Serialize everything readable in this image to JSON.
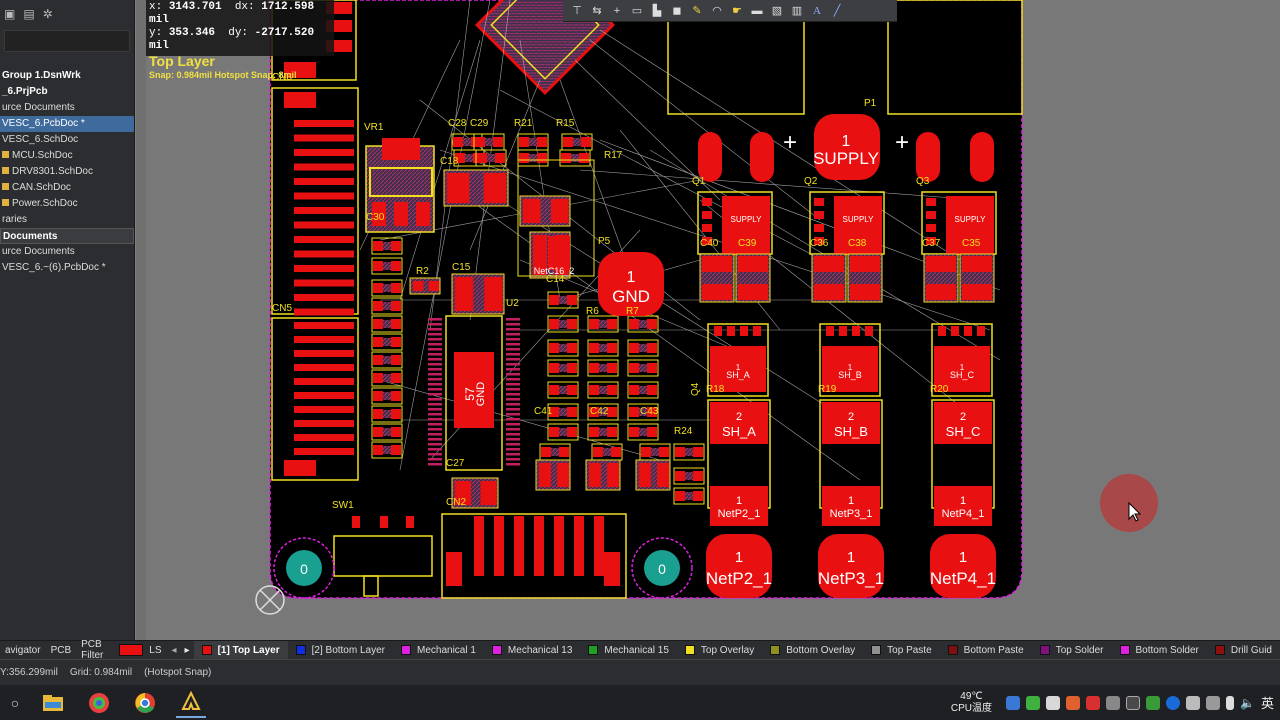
{
  "left_panel": {
    "items": [
      {
        "label": "Group 1.DsnWrk",
        "style": "bold"
      },
      {
        "label": "_6.PrjPcb",
        "style": "bold"
      },
      {
        "label": "urce Documents",
        "style": ""
      },
      {
        "label": "VESC_6.PcbDoc *",
        "style": "sel"
      },
      {
        "label": "VESC_6.SchDoc",
        "style": ""
      },
      {
        "label": "MCU.SchDoc",
        "style": "folder"
      },
      {
        "label": "DRV8301.SchDoc",
        "style": "folder"
      },
      {
        "label": "CAN.SchDoc",
        "style": "folder"
      },
      {
        "label": "Power.SchDoc",
        "style": "folder"
      },
      {
        "label": "raries",
        "style": ""
      },
      {
        "label": "Documents",
        "style": "hdr"
      },
      {
        "label": "urce Documents",
        "style": ""
      },
      {
        "label": "VESC_6.~(6).PcbDoc *",
        "style": ""
      }
    ]
  },
  "coords": {
    "x_label": "x:",
    "x": "3143.701",
    "dx_label": "dx:",
    "dx": "1712.598 mil",
    "y_label": "y:",
    "y": "353.346",
    "dy_label": "dy:",
    "dy": "-2717.520 mil",
    "layer": "Top Layer",
    "snap": "Snap: 0.984mil Hotspot Snap: 8mil"
  },
  "board_labels": {
    "cn3": "CN3",
    "cn5": "CN5",
    "vr1": "VR1",
    "sw1": "SW1",
    "cn2": "CN2",
    "u2": "U2",
    "p1": "P1",
    "p5": "P5",
    "q1": "Q1",
    "q2": "Q2",
    "q3": "Q3",
    "q4": "Q4",
    "supply_num": "1",
    "supply": "SUPPLY",
    "gnd_num": "1",
    "gnd": "GND",
    "gnd57": "57",
    "gnd57b": "GND",
    "c40": "C40",
    "c39": "C39",
    "c36": "C36",
    "c38": "C38",
    "c37": "C37",
    "c35": "C35",
    "r18": "R18",
    "r19": "R19",
    "r20": "R20",
    "sha": "SH_A",
    "shb": "SH_B",
    "shc": "SH_C",
    "netp2": "NetP2_1",
    "netp3": "NetP3_1",
    "netp4": "NetP4_1",
    "pad_one": "1",
    "pad_two": "2",
    "pad_zero": "0",
    "r17": "R17",
    "r21": "R21",
    "r15": "R15",
    "c28": "C28",
    "c29": "C29",
    "c30": "C30",
    "c18": "C18",
    "c15": "C15",
    "r2": "R2",
    "c27": "C27",
    "r24": "R24",
    "r7": "R7",
    "r6": "R6",
    "c43": "C43",
    "c42": "C42",
    "c41": "C41",
    "netc16": "NetC16_2",
    "c14": "C14",
    "plus": "+"
  },
  "toolbar_icons": [
    "filter-icon",
    "route-icon",
    "cross-icon",
    "select-rect-icon",
    "component-icon",
    "place-pad-icon",
    "draw-icon",
    "arc-icon",
    "probe-icon",
    "copper-fill-icon",
    "polygon-icon",
    "chart-icon",
    "text-icon",
    "line-icon"
  ],
  "layer_bar": {
    "tabs": [
      "avigator",
      "PCB",
      "PCB Filter"
    ],
    "ls": "LS",
    "layers": [
      {
        "label": "[1] Top Layer",
        "color": "#e81010",
        "active": true
      },
      {
        "label": "[2] Bottom Layer",
        "color": "#1030e0",
        "active": false
      },
      {
        "label": "Mechanical 1",
        "color": "#e020e0",
        "active": false
      },
      {
        "label": "Mechanical 13",
        "color": "#e020e0",
        "active": false
      },
      {
        "label": "Mechanical 15",
        "color": "#20a020",
        "active": false
      },
      {
        "label": "Top Overlay",
        "color": "#f0e020",
        "active": false
      },
      {
        "label": "Bottom Overlay",
        "color": "#909020",
        "active": false
      },
      {
        "label": "Top Paste",
        "color": "#909090",
        "active": false
      },
      {
        "label": "Bottom Paste",
        "color": "#801010",
        "active": false
      },
      {
        "label": "Top Solder",
        "color": "#801080",
        "active": false
      },
      {
        "label": "Bottom Solder",
        "color": "#e020e0",
        "active": false
      },
      {
        "label": "Drill Guid",
        "color": "#901010",
        "active": false
      }
    ]
  },
  "status": {
    "pos": "Y:356.299mil",
    "grid": "Grid: 0.984mil",
    "snap": "(Hotspot Snap)"
  },
  "taskbar": {
    "temp": "49℃",
    "cpu": "CPU温度",
    "ime": "英"
  }
}
